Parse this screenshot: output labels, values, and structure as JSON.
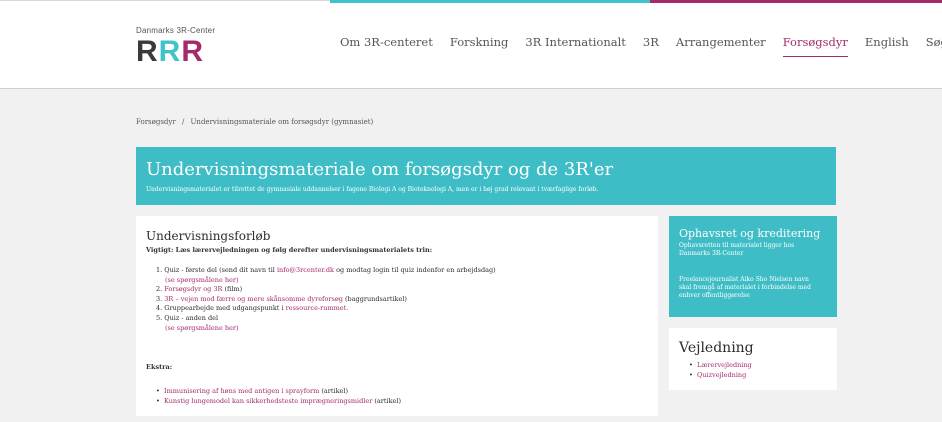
{
  "header": {
    "logo_caption": "Danmarks 3R-Center",
    "logo_letters": [
      "R",
      "R",
      "R"
    ],
    "nav": [
      "Om 3R-centeret",
      "Forskning",
      "3R Internationalt",
      "3R",
      "Arrangementer",
      "Forsøgsdyr",
      "English",
      "Søg"
    ],
    "active_nav": "Forsøgsdyr"
  },
  "colors": {
    "teal": "#3fbdc6",
    "magenta": "#a52a6a",
    "logo_dark": "#3a3a3a"
  },
  "breadcrumb": {
    "root": "Forsøgsdyr",
    "sep": "/",
    "current": "Undervisningsmateriale om forsøgsdyr (gymnasiet)"
  },
  "hero": {
    "title": "Undervisningsmateriale om forsøgsdyr og de 3R'er",
    "subtitle": "Undervisningsmaterialet er tilrettet de gymnasiale uddannelser i fagene Biologi A og Bioteknologi A, men er i høj grad relevant i tværfaglige forløb."
  },
  "main": {
    "heading": "Undervisningsforløb",
    "lead": "Vigtigt: Læs lærervejledningen og følg derefter undervisningsmaterialets trin:",
    "step1_num": "1.",
    "step1_text": "Quiz - første del (send dit navn til",
    "step1_email": "info@3rcenter.dk",
    "step1_rest": "og modtag login til quiz indenfor en arbejdsdag)",
    "step1_link": "(se spørgsmålene her)",
    "step2_num": "2.",
    "step2_link": "Forsøgsdyr og 3R",
    "step2_rest": "(film)",
    "step3_num": "3.",
    "step3_link": "3R – vejen mod færre og mere skånsomme dyreforsøg",
    "step3_rest": "(baggrundsartikel)",
    "step4_num": "4.",
    "step4_text": "Gruppearbejde med udgangspunkt i",
    "step4_link": "ressource-rummet.",
    "step5_num": "5.",
    "step5_text": "Quiz - anden del",
    "step5_link": "(se spørgsmålene her)",
    "extra_title": "Ekstra:",
    "extra1_link": "Immunisering af høns med antigen i sprayform",
    "extra1_rest": "(artikel)",
    "extra2_link": "Kunstig lungemodel kan sikkerhedsteste imprægneringsmidler",
    "extra2_rest": "(artikel)"
  },
  "sidebar": {
    "rights_title": "Ophavsret og kreditering",
    "rights_line1": "Ophavsretten til materialet ligger hos",
    "rights_line2": "Danmarks 3R-Center",
    "rights_line3": "Freelancejournalist Aiko Sho Nielsen navn",
    "rights_line4": "skal fremgå af materialet i forbindelse med",
    "rights_line5": "enhver offentliggørelse",
    "guide_title": "Vejledning",
    "guide_item1": "Lærervejledning",
    "guide_item2": "Quizvejledning"
  }
}
